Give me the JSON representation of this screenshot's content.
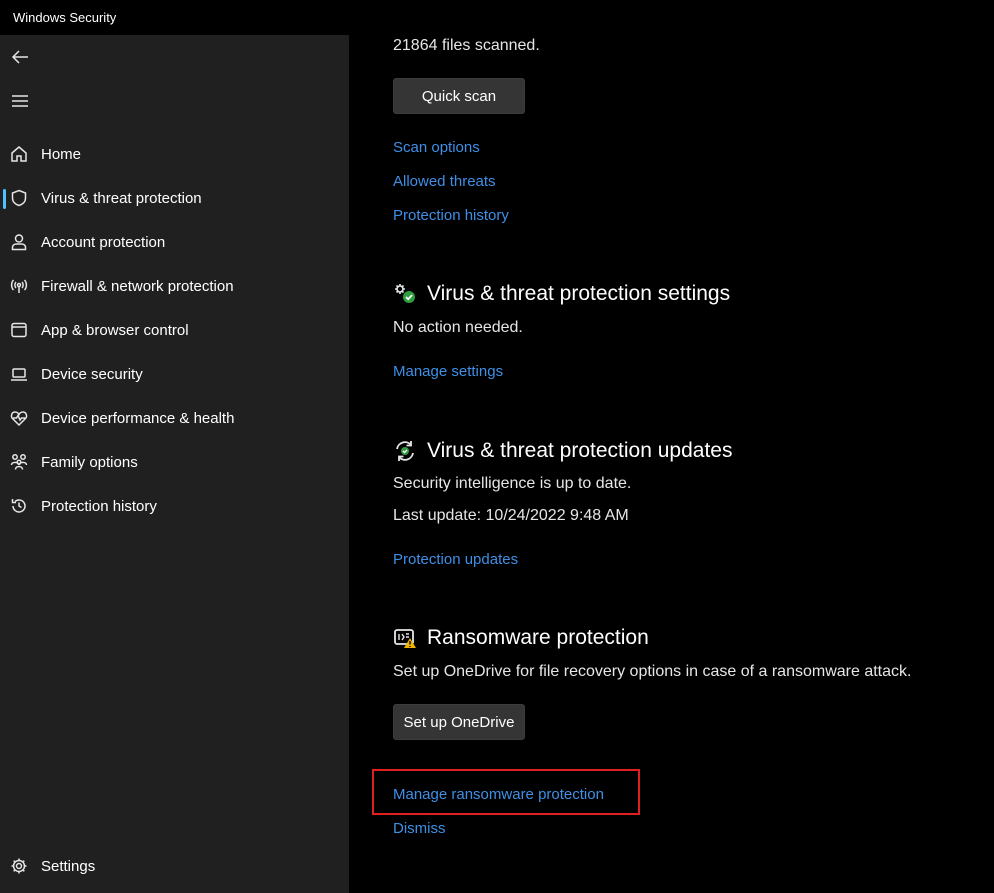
{
  "window": {
    "title": "Windows Security"
  },
  "sidebar": {
    "back_icon": "back-arrow-icon",
    "menu_icon": "hamburger-menu-icon",
    "items": [
      {
        "label": "Home",
        "icon": "home-icon"
      },
      {
        "label": "Virus & threat protection",
        "icon": "shield-icon",
        "selected": true
      },
      {
        "label": "Account protection",
        "icon": "person-icon"
      },
      {
        "label": "Firewall & network protection",
        "icon": "antenna-icon"
      },
      {
        "label": "App & browser control",
        "icon": "window-icon"
      },
      {
        "label": "Device security",
        "icon": "laptop-icon"
      },
      {
        "label": "Device performance & health",
        "icon": "heart-pulse-icon"
      },
      {
        "label": "Family options",
        "icon": "family-icon"
      },
      {
        "label": "Protection history",
        "icon": "history-icon"
      }
    ],
    "settings": {
      "label": "Settings",
      "icon": "gear-icon"
    },
    "accent_color": "#4cc2ff"
  },
  "main": {
    "scan": {
      "files_scanned": "21864 files scanned.",
      "quick_scan_label": "Quick scan",
      "links": [
        "Scan options",
        "Allowed threats",
        "Protection history"
      ]
    },
    "settings_section": {
      "title": "Virus & threat protection settings",
      "status": "No action needed.",
      "link": "Manage settings",
      "icon": "gears-check-icon"
    },
    "updates_section": {
      "title": "Virus & threat protection updates",
      "status": "Security intelligence is up to date.",
      "last_update": "Last update: 10/24/2022 9:48 AM",
      "link": "Protection updates",
      "icon": "sync-check-icon"
    },
    "ransomware_section": {
      "title": "Ransomware protection",
      "description": "Set up OneDrive for file recovery options in case of a ransomware attack.",
      "setup_button": "Set up OneDrive",
      "manage_link": "Manage ransomware protection",
      "dismiss_link": "Dismiss",
      "icon": "folder-warning-icon"
    },
    "link_color": "#3f8fe6",
    "highlight_color": "#e02020"
  }
}
